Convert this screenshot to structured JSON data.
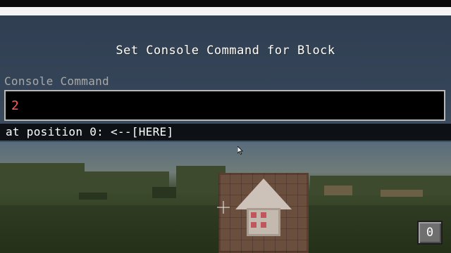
{
  "dialog": {
    "title": "Set Console Command for Block",
    "field_label": "Console Command",
    "command_value": "2",
    "error_message": "at position 0: <--[HERE]"
  },
  "hud": {
    "corner_button_label": "0"
  },
  "colors": {
    "command_text": "#ff5c5c",
    "label_text": "#a8a8a8",
    "input_border": "#b8b8b8"
  },
  "icons": {
    "cursor": "mouse-pointer-icon",
    "crosshair": "crosshair-icon"
  }
}
